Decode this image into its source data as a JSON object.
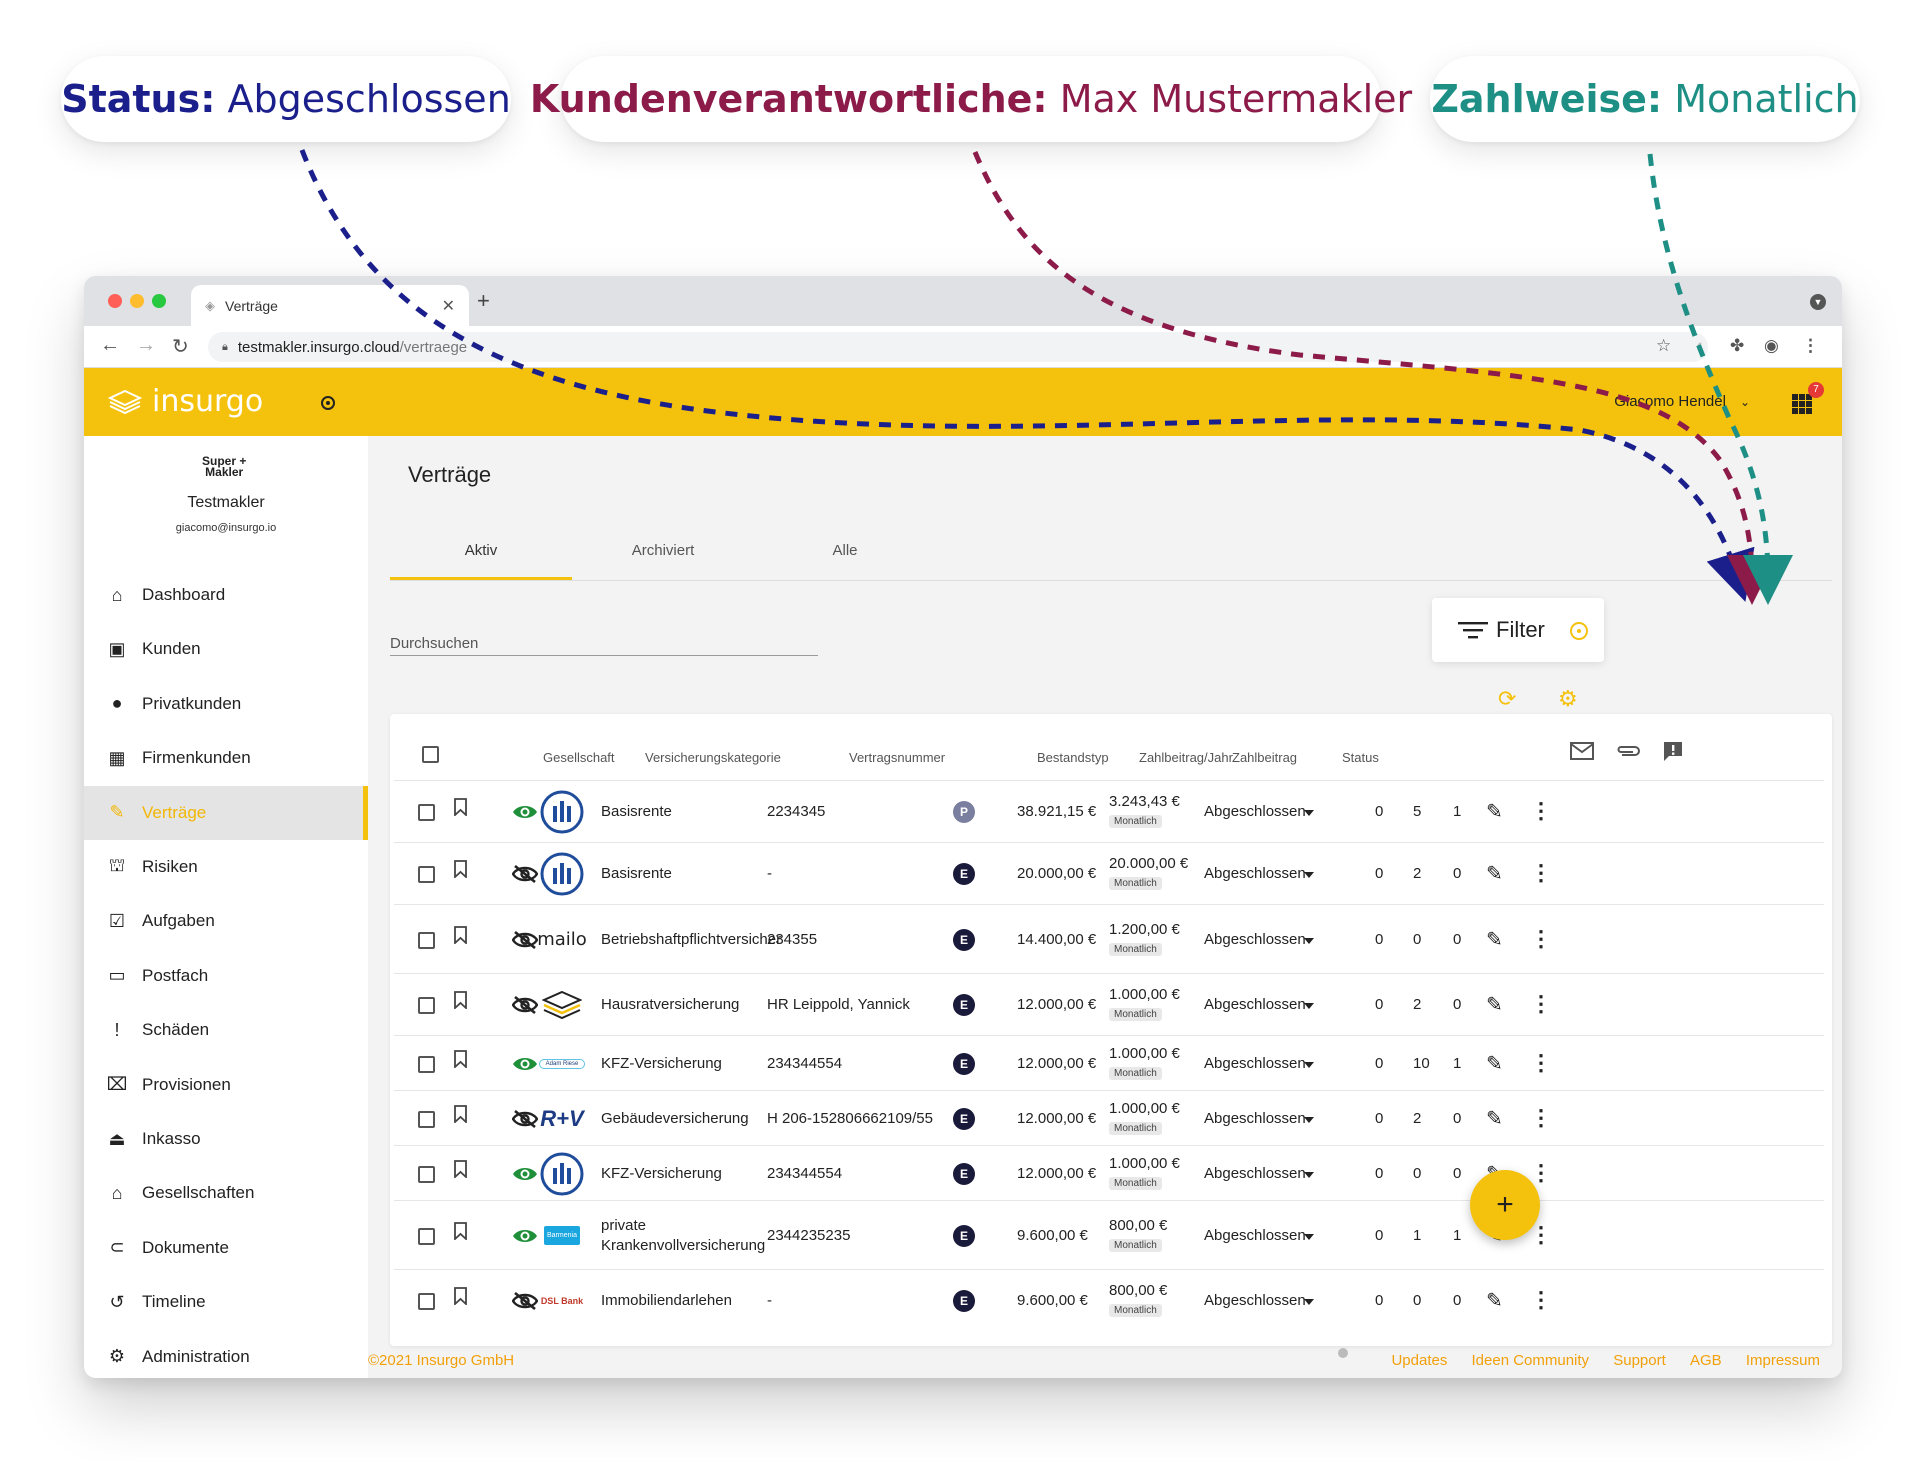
{
  "callouts": [
    {
      "key": "Status:",
      "value": "Abgeschlossen",
      "color": "#1a1f8c"
    },
    {
      "key": "Kundenverantwortliche:",
      "value": "Max Mustermakler",
      "color": "#8c1b49"
    },
    {
      "key": "Zahlweise:",
      "value": "Monatlich",
      "color": "#1e8f85"
    }
  ],
  "browser": {
    "tab_title": "Verträge",
    "url_host": "testmakler.insurgo.cloud",
    "url_path": "/vertraege"
  },
  "header": {
    "app_name": "insurgo",
    "user_name": "Giacomo Hendel",
    "apps_badge": "7",
    "brand_color": "#f4c20d"
  },
  "sidebar": {
    "brand_logo_line1": "Super +",
    "brand_logo_line2": "Makler",
    "company": "Testmakler",
    "email": "giacomo@insurgo.io",
    "items": [
      {
        "label": "Dashboard",
        "icon": "home-icon"
      },
      {
        "label": "Kunden",
        "icon": "contact-icon"
      },
      {
        "label": "Privatkunden",
        "icon": "person-icon"
      },
      {
        "label": "Firmenkunden",
        "icon": "building-icon"
      },
      {
        "label": "Verträge",
        "icon": "pencil-icon",
        "active": true
      },
      {
        "label": "Risiken",
        "icon": "risk-icon"
      },
      {
        "label": "Aufgaben",
        "icon": "checkbox-icon"
      },
      {
        "label": "Postfach",
        "icon": "inbox-icon"
      },
      {
        "label": "Schäden",
        "icon": "report-icon"
      },
      {
        "label": "Provisionen",
        "icon": "gift-icon"
      },
      {
        "label": "Inkasso",
        "icon": "eject-icon"
      },
      {
        "label": "Gesellschaften",
        "icon": "bank-icon"
      },
      {
        "label": "Dokumente",
        "icon": "attachment-icon"
      },
      {
        "label": "Timeline",
        "icon": "history-icon"
      },
      {
        "label": "Administration",
        "icon": "gear-icon"
      }
    ]
  },
  "main": {
    "title": "Verträge",
    "tabs": [
      "Aktiv",
      "Archiviert",
      "Alle"
    ],
    "active_tab": "Aktiv",
    "search_placeholder": "Durchsuchen",
    "filter_label": "Filter"
  },
  "table": {
    "headers": {
      "gesellschaft": "Gesellschaft",
      "kategorie": "Versicherungskategorie",
      "nummer": "Vertragsnummer",
      "bestandstyp": "Bestandstyp",
      "jahr": "Zahlbeitrag/Jahr",
      "beitrag": "Zahlbeitrag",
      "status": "Status"
    },
    "rows": [
      {
        "visible": true,
        "company": "allianz",
        "category": "Basisrente",
        "number": "2234345",
        "type": "P",
        "year": "38.921,15 €",
        "amount": "3.243,43 €",
        "interval": "Monatlich",
        "status": "Abgeschlossen",
        "mails": "0",
        "docs": "5",
        "notes": "1"
      },
      {
        "visible": false,
        "company": "allianz",
        "category": "Basisrente",
        "number": "-",
        "type": "E",
        "year": "20.000,00 €",
        "amount": "20.000,00 €",
        "interval": "Monatlich",
        "status": "Abgeschlossen",
        "mails": "0",
        "docs": "2",
        "notes": "0"
      },
      {
        "visible": false,
        "company": "mailo",
        "company_text": "mailo",
        "category": "Betriebshaftpflichtversicher",
        "number": "234355",
        "type": "E",
        "year": "14.400,00 €",
        "amount": "1.200,00 €",
        "interval": "Monatlich",
        "status": "Abgeschlossen",
        "mails": "0",
        "docs": "0",
        "notes": "0"
      },
      {
        "visible": false,
        "company": "insurgo",
        "category": "Hausratversicherung",
        "number": "HR Leippold, Yannick",
        "type": "E",
        "year": "12.000,00 €",
        "amount": "1.000,00 €",
        "interval": "Monatlich",
        "status": "Abgeschlossen",
        "mails": "0",
        "docs": "2",
        "notes": "0"
      },
      {
        "visible": true,
        "company": "adamriese",
        "company_text": "Adam Riese",
        "category": "KFZ-Versicherung",
        "number": "234344554",
        "type": "E",
        "year": "12.000,00 €",
        "amount": "1.000,00 €",
        "interval": "Monatlich",
        "status": "Abgeschlossen",
        "mails": "0",
        "docs": "10",
        "notes": "1"
      },
      {
        "visible": false,
        "company": "ruv",
        "company_text": "R+V",
        "category": "Gebäudeversicherung",
        "number": "H 206-152806662109/55",
        "type": "E",
        "year": "12.000,00 €",
        "amount": "1.000,00 €",
        "interval": "Monatlich",
        "status": "Abgeschlossen",
        "mails": "0",
        "docs": "2",
        "notes": "0"
      },
      {
        "visible": true,
        "company": "allianz",
        "category": "KFZ-Versicherung",
        "number": "234344554",
        "type": "E",
        "year": "12.000,00 €",
        "amount": "1.000,00 €",
        "interval": "Monatlich",
        "status": "Abgeschlossen",
        "mails": "0",
        "docs": "0",
        "notes": "0"
      },
      {
        "visible": true,
        "company": "barmenia",
        "company_text": "Barmenia",
        "category": "private",
        "category2": "Krankenvollversicherung",
        "number": "2344235235",
        "type": "E",
        "year": "9.600,00 €",
        "amount": "800,00 €",
        "interval": "Monatlich",
        "status": "Abgeschlossen",
        "mails": "0",
        "docs": "1",
        "notes": "1"
      },
      {
        "visible": false,
        "company": "dslbank",
        "company_text": "DSL Bank",
        "category": "Immobiliendarlehen",
        "number": "-",
        "type": "E",
        "year": "9.600,00 €",
        "amount": "800,00 €",
        "interval": "Monatlich",
        "status": "Abgeschlossen",
        "mails": "0",
        "docs": "0",
        "notes": "0"
      }
    ]
  },
  "fab_label": "+",
  "footer": {
    "copyright": "©2021 Insurgo GmbH",
    "links": [
      "Updates",
      "Ideen Community",
      "Support",
      "AGB",
      "Impressum"
    ]
  }
}
